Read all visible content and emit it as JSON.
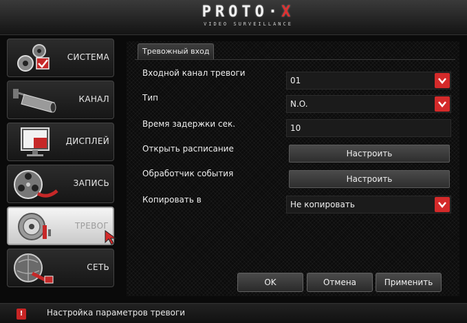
{
  "header": {
    "logo_main_a": "PROTO·",
    "logo_main_x": "X",
    "logo_sub": "VIDEO SURVEILLANCE"
  },
  "sidebar": {
    "items": [
      {
        "label": "СИСТЕМА",
        "icon": "gear-icon",
        "active": false
      },
      {
        "label": "КАНАЛ",
        "icon": "camera-icon",
        "active": false
      },
      {
        "label": "ДИСПЛЕЙ",
        "icon": "monitor-icon",
        "active": false
      },
      {
        "label": "ЗАПИСЬ",
        "icon": "film-reel-icon",
        "active": false
      },
      {
        "label": "ТРЕВОГ",
        "icon": "alarm-bell-icon",
        "active": true
      },
      {
        "label": "СЕТЬ",
        "icon": "globe-network-icon",
        "active": false
      }
    ]
  },
  "panel": {
    "tab_label": "Тревожный вход",
    "rows": {
      "input_channel": {
        "label": "Входной канал тревоги",
        "value": "01"
      },
      "type": {
        "label": "Тип",
        "value": "N.O."
      },
      "delay": {
        "label": "Время задержки сек.",
        "value": "10"
      },
      "schedule": {
        "label": "Открыть расписание",
        "button": "Настроить"
      },
      "event_handler": {
        "label": "Обработчик события",
        "button": "Настроить"
      },
      "copy_to": {
        "label": "Копировать в",
        "value": "Не копировать"
      }
    }
  },
  "buttons": {
    "ok": "OK",
    "cancel": "Отмена",
    "apply": "Применить"
  },
  "status": {
    "icon_text": "!",
    "text": "Настройка параметров тревоги"
  },
  "colors": {
    "accent": "#d42a2a",
    "panel_bg": "#0c0c0c",
    "active_item_bg": "#e6e6e6"
  }
}
